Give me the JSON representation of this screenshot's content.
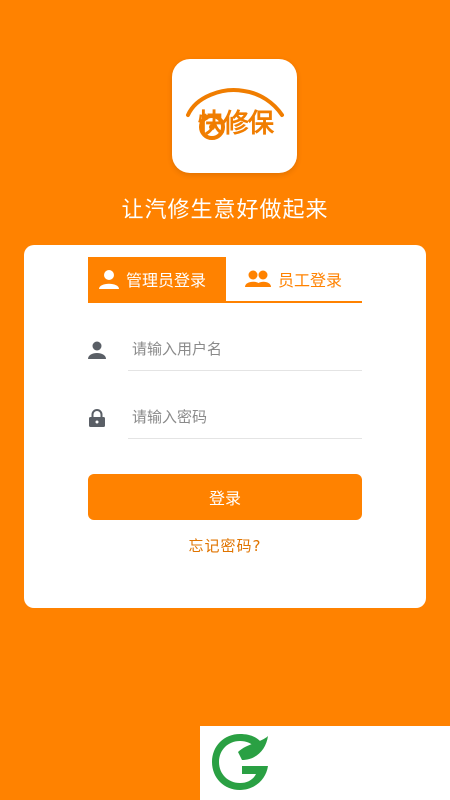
{
  "app": {
    "logo_text": "快修保",
    "slogan": "让汽修生意好做起来"
  },
  "login": {
    "tabs": [
      {
        "label": "管理员登录",
        "icon": "person-icon",
        "active": true
      },
      {
        "label": "员工登录",
        "icon": "people-icon",
        "active": false
      }
    ],
    "username_placeholder": "请输入用户名",
    "password_placeholder": "请输入密码",
    "submit_label": "登录",
    "forgot_label": "忘记密码?"
  },
  "colors": {
    "brand": "#FF8200",
    "background": "#FF8200",
    "card": "#FFFFFF",
    "icon_gray": "#5A5F66",
    "watermark_green": "#2AA043"
  }
}
